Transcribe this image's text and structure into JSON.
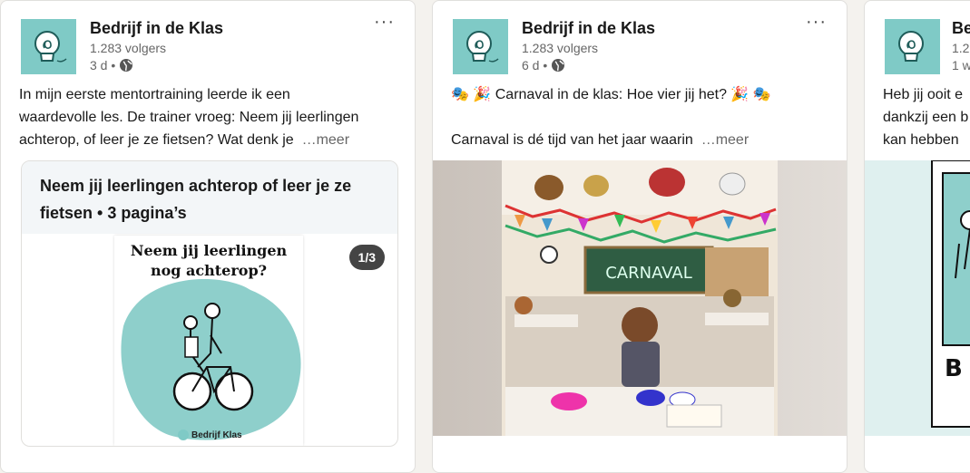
{
  "posts": [
    {
      "author": "Bedrijf in de Klas",
      "followers": "1.283 volgers",
      "time": "3 d •",
      "more": "···",
      "lines": [
        "In mijn eerste mentortraining leerde ik een",
        "waardevolle les. De trainer vroeg: Neem jij leerlingen",
        "achterop, of leer je ze fietsen? Wat denk je"
      ],
      "see_more": "…meer",
      "doc_title_lines": [
        "Neem jij leerlingen achterop of leer je ze",
        "fietsen • 3 pagina’s"
      ],
      "page_title_lines": [
        "Neem jij leerlingen",
        "nog achterop?"
      ],
      "counter": "1/3",
      "footer_logo": "Bedrijf Klas"
    },
    {
      "author": "Bedrijf in de Klas",
      "followers": "1.283 volgers",
      "time": "6 d •",
      "more": "···",
      "line1": "🎭 🎉 Carnaval in de klas: Hoe vier jij het? 🎉 🎭",
      "line2": "Carnaval is dé tijd van het jaar waarin",
      "see_more": "…meer",
      "board_text": "CARNAVAL"
    },
    {
      "author": "Bedrijf in de Klas",
      "followers": "1.2",
      "time": "1 w",
      "lines": [
        "Heb jij ooit e",
        "dankzij een b",
        "kan hebben"
      ],
      "cartoon_letter": "B"
    }
  ],
  "colors": {
    "brand_teal": "#7fcac6",
    "link_gray": "#666666"
  },
  "icons": [
    "lightbulb-logo-icon",
    "globe-icon",
    "more-options-icon"
  ]
}
